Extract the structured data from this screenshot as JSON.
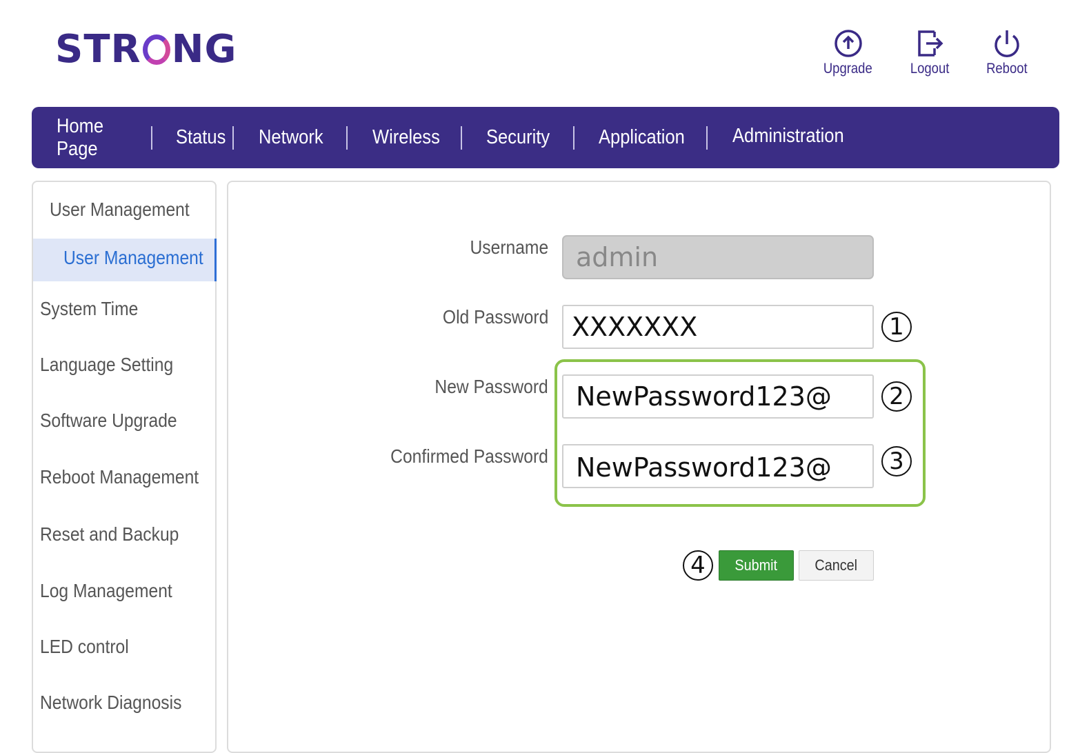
{
  "brand": {
    "logo_text_1": "STR",
    "logo_text_2": "NG"
  },
  "top_actions": [
    {
      "label": "Upgrade",
      "icon": "upgrade-icon"
    },
    {
      "label": "Logout",
      "icon": "logout-icon"
    },
    {
      "label": "Reboot",
      "icon": "power-icon"
    }
  ],
  "nav": {
    "items": [
      "Home Page",
      "Status",
      "Network",
      "Wireless",
      "Security",
      "Application",
      "Administration"
    ],
    "active": "Administration"
  },
  "sidebar": {
    "group": "User Management",
    "active_sub": "User Management",
    "items": [
      "System Time",
      "Language Setting",
      "Software Upgrade",
      "Reboot Management",
      "Reset and Backup",
      "Log Management",
      "LED control",
      "Network Diagnosis"
    ]
  },
  "form": {
    "username": {
      "label": "Username",
      "value": "admin"
    },
    "old_password": {
      "label": "Old Password",
      "value": "XXXXXXX",
      "step": "1"
    },
    "new_password": {
      "label": "New Password",
      "value": "NewPassword123@",
      "step": "2"
    },
    "confirm_password": {
      "label": "Confirmed Password",
      "value": "NewPassword123@",
      "step": "3"
    },
    "submit_step": "4",
    "submit_label": "Submit",
    "cancel_label": "Cancel"
  },
  "colors": {
    "brand_purple": "#3b2d85",
    "submit_green": "#3a9a3a",
    "highlight_green": "#8bc34a",
    "active_blue": "#2a6ed2"
  }
}
